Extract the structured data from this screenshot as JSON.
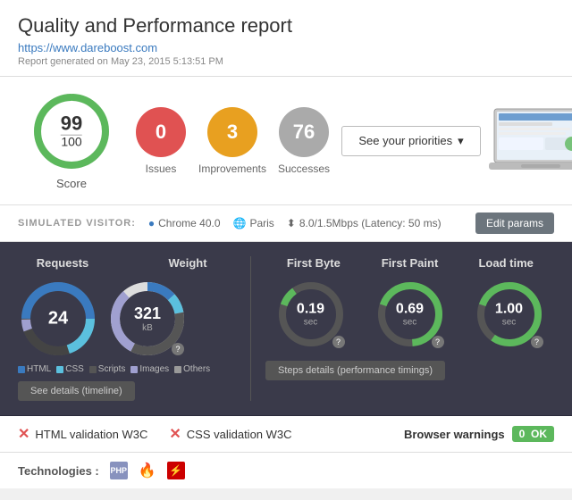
{
  "header": {
    "title": "Quality and Performance report",
    "url": "https://www.dareboost.com",
    "report_date": "Report generated on May 23, 2015 5:13:51 PM"
  },
  "summary": {
    "score": "99",
    "score_denom": "100",
    "score_label": "Score",
    "issues": {
      "value": "0",
      "label": "Issues"
    },
    "improvements": {
      "value": "3",
      "label": "Improvements"
    },
    "successes": {
      "value": "76",
      "label": "Successes"
    },
    "priorities_btn": "See your priorities"
  },
  "visitor": {
    "label": "SIMULATED VISITOR:",
    "browser": "Chrome 40.0",
    "location": "Paris",
    "speed": "8.0/1.5Mbps (Latency: 50 ms)",
    "edit_btn": "Edit params"
  },
  "performance": {
    "requests_title": "Requests",
    "weight_title": "Weight",
    "requests_value": "24",
    "weight_value": "321",
    "weight_unit": "kB",
    "legend": [
      {
        "label": "HTML",
        "color": "#3a7abf"
      },
      {
        "label": "CSS",
        "color": "#5bc0de"
      },
      {
        "label": "Scripts",
        "color": "#555"
      },
      {
        "label": "Images",
        "color": "#a0a0d0"
      },
      {
        "label": "Others",
        "color": "#999"
      }
    ],
    "details_btn": "See details (timeline)",
    "timings": [
      {
        "title": "First Byte",
        "value": "0.19",
        "unit": "sec",
        "color": "#5cb85c",
        "pct": 19
      },
      {
        "title": "First Paint",
        "value": "0.69",
        "unit": "sec",
        "color": "#5cb85c",
        "pct": 69
      },
      {
        "title": "Load time",
        "value": "1.00",
        "unit": "sec",
        "color": "#5cb85c",
        "pct": 100
      }
    ],
    "steps_btn": "Steps details (performance timings)"
  },
  "validation": {
    "html_label": "HTML validation W3C",
    "css_label": "CSS validation W3C",
    "browser_warnings_label": "Browser warnings",
    "ok_value": "0",
    "ok_label": "OK"
  },
  "technologies": {
    "label": "Technologies :",
    "items": [
      {
        "name": "php",
        "symbol": "PHP"
      },
      {
        "name": "fire",
        "symbol": "🔥"
      },
      {
        "name": "rails",
        "symbol": "⚡"
      }
    ]
  }
}
